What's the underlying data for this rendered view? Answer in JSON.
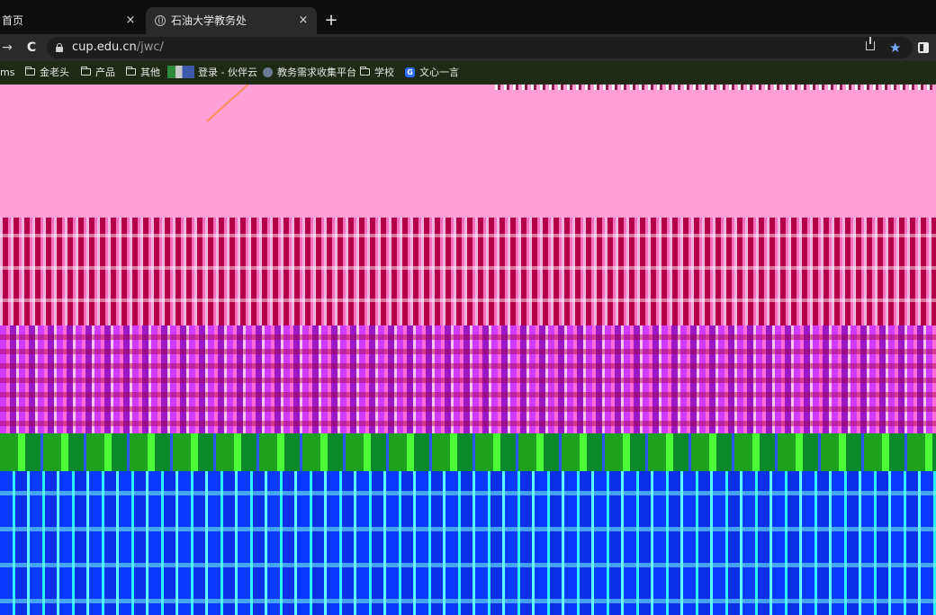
{
  "tabs": [
    {
      "title": "首页",
      "close": "×",
      "active": false
    },
    {
      "title": "石油大学教务处",
      "close": "×",
      "active": true
    }
  ],
  "new_tab_label": "+",
  "toolbar": {
    "forward": "→",
    "reload": "C",
    "url_host": "cup.edu.cn",
    "url_path": "/jwc/",
    "bookmark_star": "★"
  },
  "bookmarks": [
    {
      "label": "ms",
      "icon": "none"
    },
    {
      "label": "金老头",
      "icon": "folder-icon"
    },
    {
      "label": "产品",
      "icon": "folder-icon"
    },
    {
      "label": "其他",
      "icon": "folder-icon"
    },
    {
      "label": "登录 - 伙伴云",
      "icon": "thumbnail-icon"
    },
    {
      "label": "教务需求收集平台",
      "icon": "globe-icon"
    },
    {
      "label": "学校",
      "icon": "folder-icon"
    },
    {
      "label": "文心一言",
      "icon": "wenxin-icon",
      "badge": "G"
    }
  ],
  "colors": {
    "tab_bg": "#0d0d0d",
    "active_tab": "#2a2a2a",
    "omnibox": "#1d1d1d",
    "bookmarks_bg": "#1f2a16",
    "content_pink": "#ff9fd6",
    "content_crimson": "#b3004b",
    "content_magenta": "#c02ad8",
    "content_green": "#149a1e",
    "content_blue": "#0a37ff"
  }
}
